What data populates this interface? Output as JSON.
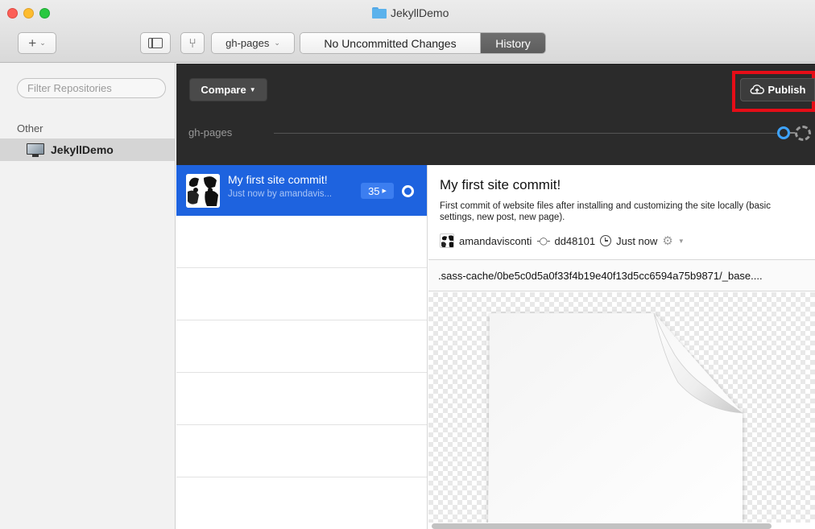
{
  "window": {
    "title": "JekyllDemo"
  },
  "toolbar": {
    "add_label": "+",
    "branch": "gh-pages",
    "uncommitted_label": "No Uncommitted Changes",
    "history_label": "History"
  },
  "sidebar": {
    "filter_placeholder": "Filter Repositories",
    "section": "Other",
    "repo": "JekyllDemo"
  },
  "header": {
    "compare_label": "Compare",
    "publish_label": "Publish",
    "branch_label": "gh-pages"
  },
  "commits": [
    {
      "title": "My first site commit!",
      "meta": "Just now by amandavis...",
      "count": "35"
    }
  ],
  "detail": {
    "title": "My first site commit!",
    "description": "First commit of website files after installing and customizing the site locally (basic settings, new post, new page).",
    "author": "amandavisconti",
    "sha": "dd48101",
    "time": "Just now",
    "file_path": ".sass-cache/0be5c0d5a0f33f4b19e40f13d5cc6594a75b9871/_base...."
  },
  "colors": {
    "accent_blue": "#1e63df",
    "highlight_red": "#e60d17",
    "timeline_blue": "#3ea3ff"
  }
}
